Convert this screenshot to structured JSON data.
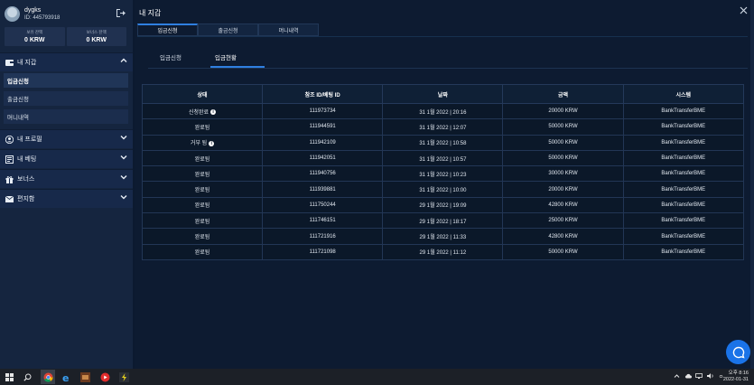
{
  "sidebar": {
    "username": "dygks",
    "user_id": "ID: 445793918",
    "balances": [
      {
        "label": "보유 잔액",
        "value": "0 KRW"
      },
      {
        "label": "보너스 잔액",
        "value": "0 KRW"
      }
    ],
    "menu": [
      {
        "label": "내 지갑",
        "icon": "wallet-icon",
        "expanded": true,
        "items": [
          {
            "label": "입금신청",
            "active": true
          },
          {
            "label": "출금신청",
            "active": false
          },
          {
            "label": "머니내역",
            "active": false
          }
        ]
      },
      {
        "label": "내 프로필",
        "icon": "user-icon",
        "expanded": false
      },
      {
        "label": "내 베팅",
        "icon": "bet-icon",
        "expanded": false
      },
      {
        "label": "보너스",
        "icon": "gift-icon",
        "expanded": false
      },
      {
        "label": "편지함",
        "icon": "mail-icon",
        "expanded": false
      }
    ]
  },
  "main": {
    "title": "내 지갑",
    "tabs": [
      {
        "label": "입금신청",
        "active": true
      },
      {
        "label": "출금신청",
        "active": false
      },
      {
        "label": "머니내역",
        "active": false
      }
    ],
    "subtabs": [
      {
        "label": "입금신청",
        "active": false
      },
      {
        "label": "입금현황",
        "active": true
      }
    ],
    "table": {
      "headers": [
        "상태",
        "참조 ID/베팅 ID",
        "날짜",
        "금액",
        "시스템"
      ],
      "rows": [
        {
          "status": "신청완료",
          "info": true,
          "ref": "111973734",
          "date": "31 1월 2022 | 20:16",
          "amount": "20000 KRW",
          "system": "BankTransferBME"
        },
        {
          "status": "완료됨",
          "info": false,
          "ref": "111944591",
          "date": "31 1월 2022 | 12:07",
          "amount": "50000 KRW",
          "system": "BankTransferBME"
        },
        {
          "status": "거부 됨",
          "info": true,
          "ref": "111942109",
          "date": "31 1월 2022 | 10:58",
          "amount": "50000 KRW",
          "system": "BankTransferBME"
        },
        {
          "status": "완료됨",
          "info": false,
          "ref": "111942051",
          "date": "31 1월 2022 | 10:57",
          "amount": "50000 KRW",
          "system": "BankTransferBME"
        },
        {
          "status": "완료됨",
          "info": false,
          "ref": "111940756",
          "date": "31 1월 2022 | 10:23",
          "amount": "30000 KRW",
          "system": "BankTransferBME"
        },
        {
          "status": "완료됨",
          "info": false,
          "ref": "111939881",
          "date": "31 1월 2022 | 10:00",
          "amount": "20000 KRW",
          "system": "BankTransferBME"
        },
        {
          "status": "완료됨",
          "info": false,
          "ref": "111750244",
          "date": "29 1월 2022 | 19:09",
          "amount": "42800 KRW",
          "system": "BankTransferBME"
        },
        {
          "status": "완료됨",
          "info": false,
          "ref": "111746151",
          "date": "29 1월 2022 | 18:17",
          "amount": "25000 KRW",
          "system": "BankTransferBME"
        },
        {
          "status": "완료됨",
          "info": false,
          "ref": "111721916",
          "date": "29 1월 2022 | 11:33",
          "amount": "42800 KRW",
          "system": "BankTransferBME"
        },
        {
          "status": "완료됨",
          "info": false,
          "ref": "111721098",
          "date": "29 1월 2022 | 11:12",
          "amount": "50000 KRW",
          "system": "BankTransferBME"
        }
      ]
    }
  },
  "taskbar": {
    "time": "오후 8:16",
    "date": "2022-01-31",
    "tray_text": "ㅇ"
  },
  "colors": {
    "accent": "#2f7fe0",
    "chat": "#1a73e8"
  }
}
